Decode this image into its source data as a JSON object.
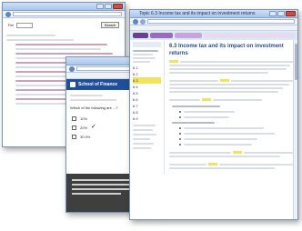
{
  "windows": {
    "back": {
      "search_label": "Rel",
      "search_button": "Search"
    },
    "middle": {
      "brand": "School of Finance",
      "question_label": "Which of the following are ...?",
      "options": [
        {
          "label": "10%",
          "checked": false
        },
        {
          "label": "20%",
          "checked": true
        },
        {
          "label": "30.9%",
          "checked": false
        }
      ],
      "check_icon": "check-icon"
    },
    "front": {
      "title": "Topic 6.3 Income tax and its impact on investment returns - Windows Internet Explorer",
      "heading": "6.3 Income tax and its impact on investment returns",
      "sidebar_items": [
        "6.1",
        "6.2",
        "6.3",
        "6.4",
        "6.5",
        "6.6",
        "6.7",
        "6.8",
        "6.9"
      ]
    }
  },
  "colors": {
    "title_bar": "#b7cdee",
    "highlight": "#f3e25c",
    "heading_blue": "#2b4c8c",
    "school_bar": "#1f4f9a"
  }
}
